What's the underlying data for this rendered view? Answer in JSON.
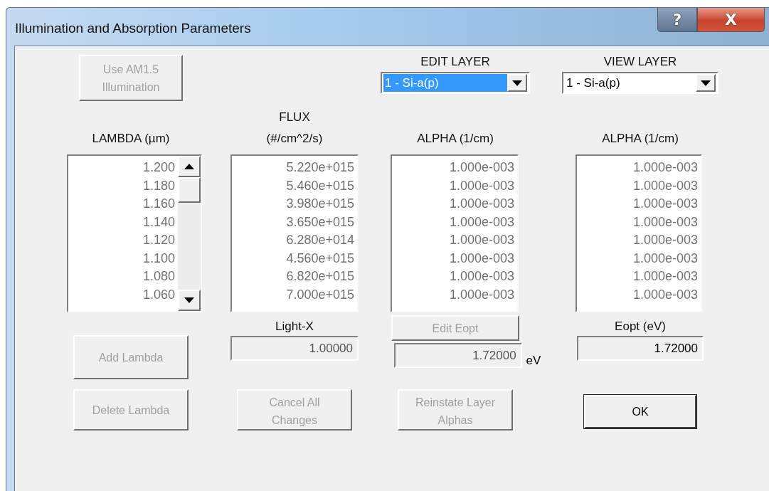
{
  "window": {
    "title": "Illumination and Absorption Parameters",
    "controls": [
      {
        "kind": "help",
        "label": "?"
      },
      {
        "kind": "close",
        "label": "X"
      }
    ]
  },
  "use_am15_button": {
    "label": "Use AM1.5 Illumination",
    "disabled": true
  },
  "edit_layer": {
    "label": "EDIT LAYER",
    "value": "1 - Si-a(p)",
    "focused": true
  },
  "view_layer": {
    "label": "VIEW LAYER",
    "value": "1 - Si-a(p)",
    "focused": false
  },
  "lists": [
    {
      "header": [
        "LAMBDA (µm)"
      ],
      "disabled": true,
      "scrollbar": true,
      "values": [
        "1.200",
        "1.180",
        "1.160",
        "1.140",
        "1.120",
        "1.100",
        "1.080",
        "1.060"
      ]
    },
    {
      "header": [
        "FLUX",
        "(#/cm^2/s)"
      ],
      "disabled": true,
      "scrollbar": false,
      "values": [
        "5.220e+015",
        "5.460e+015",
        "3.980e+015",
        "3.650e+015",
        "6.280e+014",
        "4.560e+015",
        "6.820e+015",
        "7.000e+015"
      ]
    },
    {
      "header": [
        "ALPHA (1/cm)"
      ],
      "disabled": true,
      "scrollbar": false,
      "values": [
        "1.000e-003",
        "1.000e-003",
        "1.000e-003",
        "1.000e-003",
        "1.000e-003",
        "1.000e-003",
        "1.000e-003",
        "1.000e-003"
      ]
    },
    {
      "header": [
        "ALPHA (1/cm)"
      ],
      "disabled": true,
      "scrollbar": false,
      "values": [
        "1.000e-003",
        "1.000e-003",
        "1.000e-003",
        "1.000e-003",
        "1.000e-003",
        "1.000e-003",
        "1.000e-003",
        "1.000e-003"
      ]
    }
  ],
  "add_lambda_button": {
    "label": "Add Lambda",
    "disabled": true
  },
  "light_x": {
    "label": "Light-X",
    "value": "1.00000",
    "disabled": true
  },
  "edit_eopt": {
    "button": {
      "label": "Edit Eopt",
      "disabled": true
    },
    "value": "1.72000",
    "disabled": true,
    "unit": "eV"
  },
  "eopt": {
    "label": "Eopt (eV)",
    "value": "1.72000",
    "disabled": false
  },
  "bottom_buttons": [
    {
      "label": "Delete Lambda",
      "disabled": true
    },
    {
      "label": "Cancel All Changes",
      "disabled": true
    },
    {
      "label": "Reinstate Layer Alphas",
      "disabled": true
    },
    {
      "label": "OK",
      "disabled": false
    }
  ]
}
